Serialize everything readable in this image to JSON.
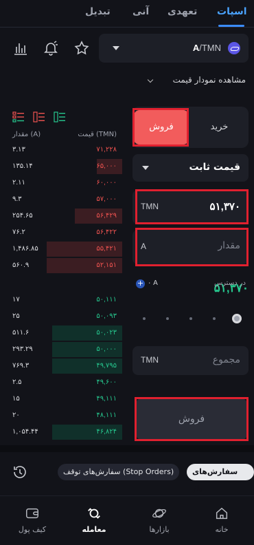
{
  "tabs": [
    {
      "label": "اسپات",
      "active": true
    },
    {
      "label": "تعهدی",
      "active": false
    },
    {
      "label": "آنی",
      "active": false
    },
    {
      "label": "تبدیل",
      "active": false
    }
  ],
  "pair": {
    "base": "A",
    "quote": "/TMN"
  },
  "chart_link": "مشاهده نمودار قیمت",
  "orderbook": {
    "header_amount": "مقدار (A)",
    "header_price": "قیمت (TMN)",
    "asks": [
      {
        "amount": "۳.۱۳",
        "price": "۷۱,۲۲۸",
        "depth": 0.0
      },
      {
        "amount": "۱۳۵.۱۴",
        "price": "۶۵,۰۰۰",
        "depth": 0.34
      },
      {
        "amount": "۲.۱۱",
        "price": "۶۰,۰۰۰",
        "depth": 0.0
      },
      {
        "amount": "۹.۳",
        "price": "۵۷,۰۰۰",
        "depth": 0.0
      },
      {
        "amount": "۲۵۴.۶۵",
        "price": "۵۶,۴۲۹",
        "depth": 0.63
      },
      {
        "amount": "۷۶.۲",
        "price": "۵۶,۴۲۲",
        "depth": 0.0
      },
      {
        "amount": "۱,۴۸۶.۸۵",
        "price": "۵۵,۴۲۱",
        "depth": 1.0
      },
      {
        "amount": "۵۶۰.۹",
        "price": "۵۲,۱۵۱",
        "depth": 1.0
      }
    ],
    "last_price": "۵۱,۳۷۰",
    "bids": [
      {
        "amount": "۱۷",
        "price": "۵۰,۱۱۱",
        "depth": 0.0
      },
      {
        "amount": "۲۵",
        "price": "۵۰,۰۹۳",
        "depth": 0.0
      },
      {
        "amount": "۵۱۱.۶",
        "price": "۵۰,۰۲۳",
        "depth": 0.93
      },
      {
        "amount": "۲۹۳.۲۹",
        "price": "۵۰,۰۰۰",
        "depth": 0.93
      },
      {
        "amount": "۷۶۹.۳",
        "price": "۴۹,۷۹۵",
        "depth": 0.93
      },
      {
        "amount": "۲.۵",
        "price": "۴۹,۶۰۰",
        "depth": 0.0
      },
      {
        "amount": "۱۵",
        "price": "۴۹,۱۱۱",
        "depth": 0.0
      },
      {
        "amount": "۲۰",
        "price": "۴۸,۱۱۱",
        "depth": 0.0
      },
      {
        "amount": "۱,۰۵۴.۴۴",
        "price": "۴۶,۸۲۴",
        "depth": 0.93
      }
    ]
  },
  "form": {
    "buy_label": "خرید",
    "sell_label": "فروش",
    "order_type": "قیمت ثابت",
    "price_unit": "TMN",
    "price_value": "۵۱,۳۷۰",
    "amount_unit": "A",
    "amount_placeholder": "مقدار",
    "available_label": "در دسترس",
    "available_value": "۰ A",
    "slider_percent": 100,
    "total_unit": "TMN",
    "total_placeholder": "مجموع",
    "submit_label": "فروش"
  },
  "orders_bar": {
    "open_orders": "سفارش‌های باز",
    "stop_orders": "سفارش‌های توقف (Stop Orders)"
  },
  "nav": [
    {
      "label": "خانه",
      "icon": "home-icon",
      "active": false
    },
    {
      "label": "بازارها",
      "icon": "planet-icon",
      "active": false
    },
    {
      "label": "معامله",
      "icon": "trade-icon",
      "active": true
    },
    {
      "label": "کیف پول",
      "icon": "wallet-icon",
      "active": false
    }
  ],
  "colors": {
    "accent": "#3b8cff",
    "sell": "#f25c5c",
    "ask": "#ef5350",
    "bid": "#26c78e",
    "background": "#121319"
  }
}
